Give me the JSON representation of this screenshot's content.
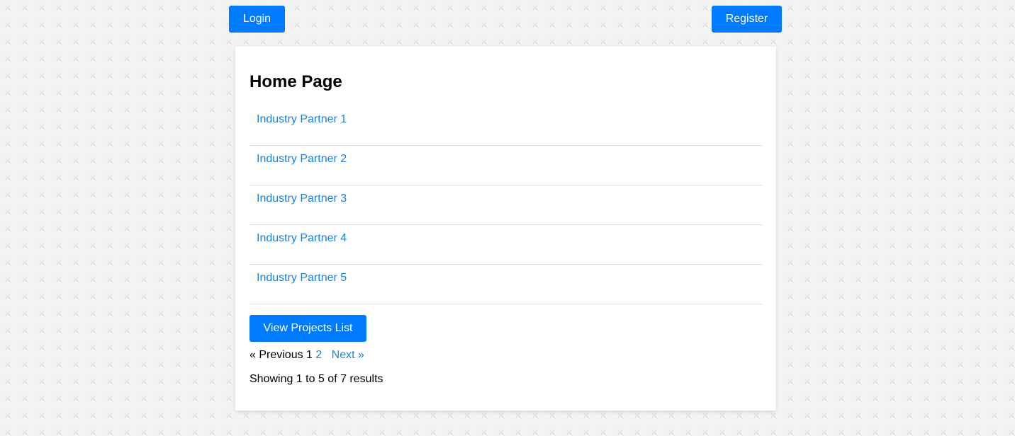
{
  "header": {
    "login_label": "Login",
    "register_label": "Register"
  },
  "main": {
    "title": "Home Page",
    "partners": [
      {
        "label": "Industry Partner 1"
      },
      {
        "label": "Industry Partner 2"
      },
      {
        "label": "Industry Partner 3"
      },
      {
        "label": "Industry Partner 4"
      },
      {
        "label": "Industry Partner 5"
      }
    ],
    "view_projects_label": "View Projects List",
    "pagination": {
      "previous_label": "« Previous",
      "current_page": "1",
      "next_page": "2",
      "next_label": "Next »"
    },
    "results_summary": "Showing 1 to 5 of 7 results"
  },
  "colors": {
    "accent": "#007bff",
    "link": "#1a82e2",
    "background": "#f3f3f3"
  }
}
